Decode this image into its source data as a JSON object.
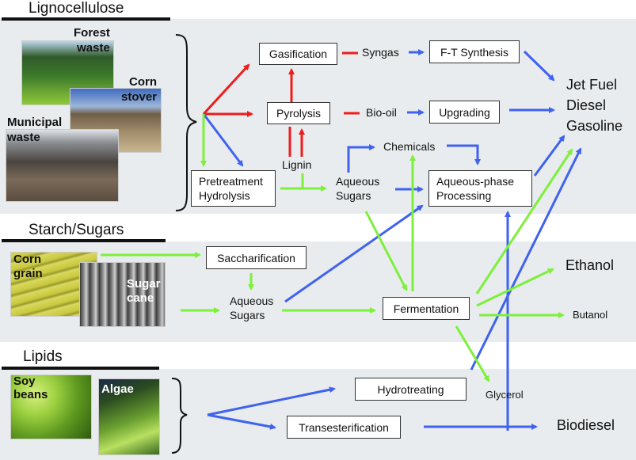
{
  "sections": {
    "lignocellulose": {
      "title": "Lignocellulose",
      "feedstocks": [
        "Forest waste",
        "Corn stover",
        "Municipal waste"
      ]
    },
    "starch": {
      "title": "Starch/Sugars",
      "feedstocks": [
        "Corn grain",
        "Sugar cane"
      ]
    },
    "lipids": {
      "title": "Lipids",
      "feedstocks": [
        "Soy beans",
        "Algae"
      ]
    }
  },
  "captions": {
    "forest": "Forest\nwaste",
    "stover": "Corn\nstover",
    "municipal": "Municipal\nwaste",
    "corn": "Corn\ngrain",
    "cane": "Sugar\ncane",
    "soy": "Soy\nbeans",
    "algae": "Algae"
  },
  "process_boxes": {
    "gasification": "Gasification",
    "ft_synthesis": "F-T Synthesis",
    "pyrolysis": "Pyrolysis",
    "upgrading": "Upgrading",
    "pretreatment": "Pretreatment\nHydrolysis",
    "aqueous_phase": "Aqueous-phase\nProcessing",
    "saccharification": "Saccharification",
    "fermentation": "Fermentation",
    "hydrotreating": "Hydrotreating",
    "transesterification": "Transesterification"
  },
  "intermediates": {
    "syngas": "Syngas",
    "bio_oil": "Bio-oil",
    "lignin": "Lignin",
    "chemicals": "Chemicals",
    "aqueous_sugars_1": "Aqueous\nSugars",
    "aqueous_sugars_2": "Aqueous\nSugars",
    "glycerol": "Glycerol"
  },
  "products": {
    "jet_fuel": "Jet Fuel",
    "diesel": "Diesel",
    "gasoline": "Gasoline",
    "ethanol": "Ethanol",
    "butanol": "Butanol",
    "biodiesel": "Biodiesel"
  },
  "colors": {
    "thermochemical": "#ee1c1c",
    "catalytic": "#3f62f0",
    "biological": "#7cf03a",
    "panel": "#e9ecee"
  }
}
